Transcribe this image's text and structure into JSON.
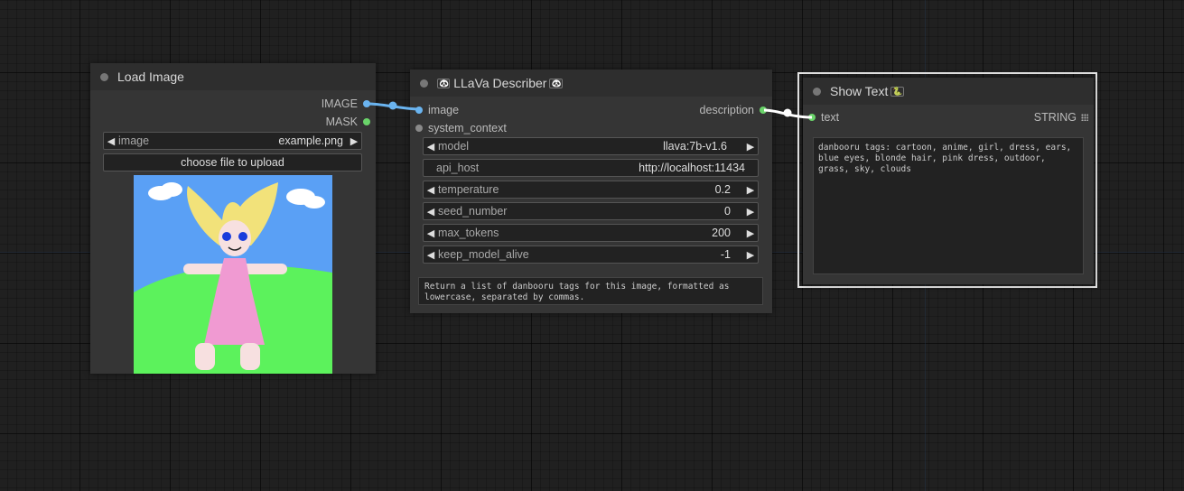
{
  "load_image": {
    "title": "Load Image",
    "outputs": [
      "IMAGE",
      "MASK"
    ],
    "image_widget": {
      "label": "image",
      "value": "example.png"
    },
    "upload_label": "choose file to upload"
  },
  "llava": {
    "title": "LLaVa Describer",
    "badge": "🐼",
    "inputs": [
      "image",
      "system_context"
    ],
    "output": "description",
    "widgets": [
      {
        "label": "model",
        "value": "llava:7b-v1.6",
        "arrows": true
      },
      {
        "label": "api_host",
        "value": "http://localhost:11434",
        "arrows": false
      },
      {
        "label": "temperature",
        "value": "0.2",
        "arrows": true
      },
      {
        "label": "seed_number",
        "value": "0",
        "arrows": true
      },
      {
        "label": "max_tokens",
        "value": "200",
        "arrows": true
      },
      {
        "label": "keep_model_alive",
        "value": "-1",
        "arrows": true
      }
    ],
    "prompt": "Return a list of danbooru tags for this image, formatted as lowercase, separated by commas."
  },
  "show_text": {
    "title": "Show Text",
    "badge": "🐍",
    "input": "text",
    "output": "STRING",
    "text": "danbooru tags: cartoon, anime, girl, dress, ears, blue eyes, blonde hair, pink dress, outdoor, grass, sky, clouds"
  },
  "colors": {
    "image_link": "#6ab4f0",
    "string_link": "#ffffff",
    "image_slot": "#6ab4f0",
    "string_slot": "#6ad46a"
  }
}
